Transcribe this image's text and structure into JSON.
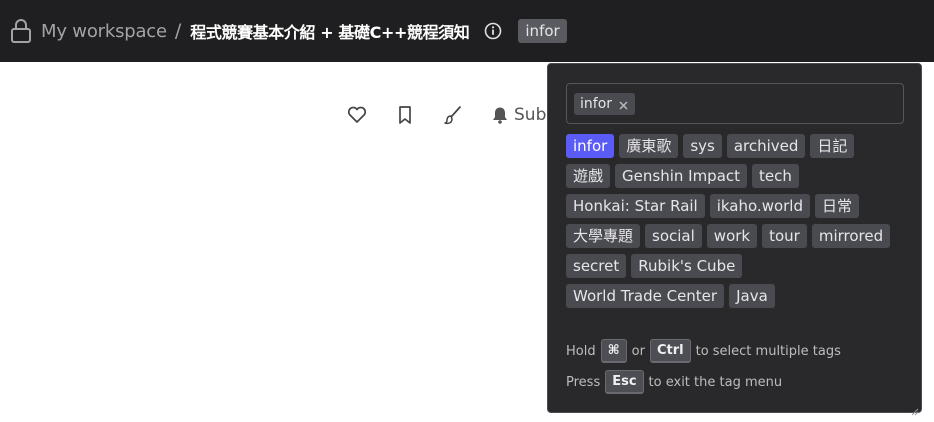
{
  "breadcrumb": {
    "workspace": "My workspace",
    "separator": "/",
    "title": "程式競賽基本介紹 + 基礎C++競程須知",
    "tag": "infor"
  },
  "actions": {
    "subscribe_label": "Subscribe"
  },
  "tag_menu": {
    "selected_chips": [
      "infor"
    ],
    "rows": [
      [
        {
          "label": "infor",
          "active": true
        },
        {
          "label": "廣東歌"
        },
        {
          "label": "sys"
        },
        {
          "label": "archived"
        },
        {
          "label": "日記"
        }
      ],
      [
        {
          "label": "遊戲"
        },
        {
          "label": "Genshin Impact"
        },
        {
          "label": "tech"
        }
      ],
      [
        {
          "label": "Honkai: Star Rail"
        },
        {
          "label": "ikaho.world"
        },
        {
          "label": "日常"
        }
      ],
      [
        {
          "label": "大學專題"
        },
        {
          "label": "social"
        },
        {
          "label": "work"
        },
        {
          "label": "tour"
        },
        {
          "label": "mirrored"
        }
      ],
      [
        {
          "label": "secret"
        },
        {
          "label": "Rubik's Cube"
        }
      ],
      [
        {
          "label": "World Trade Center"
        },
        {
          "label": "Java"
        }
      ]
    ],
    "hint1": {
      "prefix": "Hold",
      "key1": "⌘",
      "middle": "or",
      "key2": "Ctrl",
      "suffix": "to select multiple tags"
    },
    "hint2": {
      "prefix": "Press",
      "key": "Esc",
      "suffix": "to exit the tag menu"
    }
  },
  "colors": {
    "topbar_bg": "#1f1f21",
    "menu_bg": "#29292c",
    "tag_bg": "#4a4b50",
    "active_tag_bg": "#5b5cf6"
  }
}
